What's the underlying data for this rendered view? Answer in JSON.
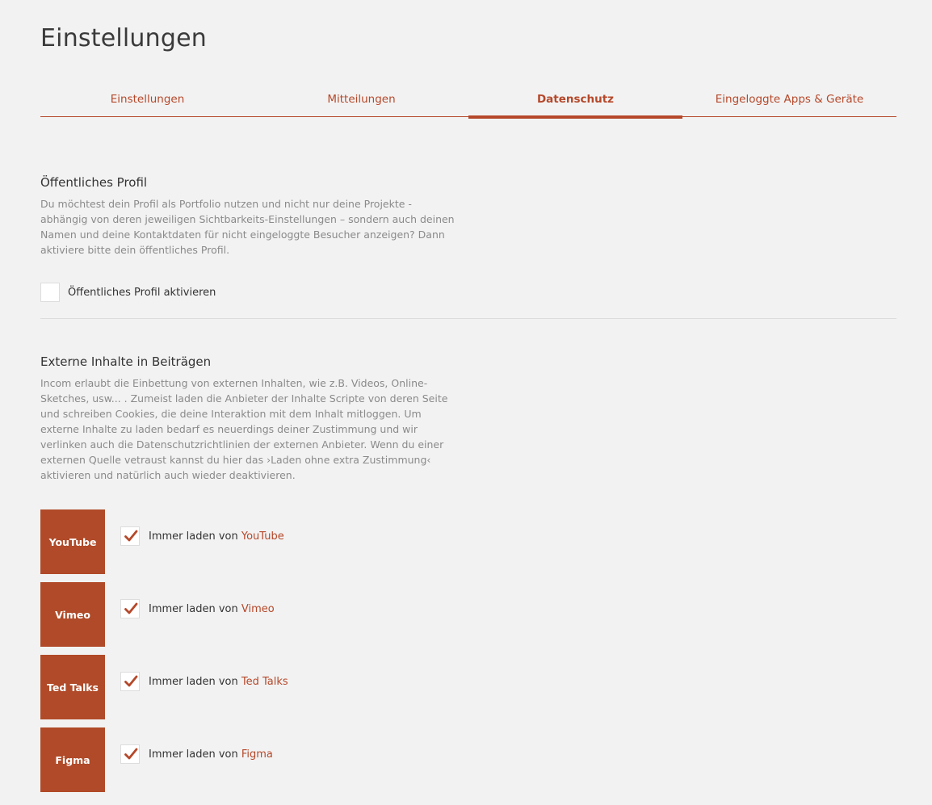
{
  "page": {
    "title": "Einstellungen"
  },
  "tabs": [
    {
      "label": "Einstellungen",
      "active": false
    },
    {
      "label": "Mitteilungen",
      "active": false
    },
    {
      "label": "Datenschutz",
      "active": true
    },
    {
      "label": "Eingeloggte Apps & Geräte",
      "active": false
    }
  ],
  "public_profile": {
    "heading": "Öffentliches Profil",
    "description": "Du möchtest dein Profil als Portfolio nutzen und nicht nur deine Projekte - abhängig von deren jeweiligen Sichtbarkeits-Einstellungen – sondern auch deinen Namen und deine Kontaktdaten für nicht eingeloggte Besucher anzeigen? Dann aktiviere bitte dein öffentliches Profil.",
    "checkbox_label": "Öffentliches Profil aktivieren",
    "checked": false
  },
  "external_content": {
    "heading": "Externe Inhalte in Beiträgen",
    "description": "Incom erlaubt die Einbettung von externen Inhalten, wie z.B. Videos, Online-Sketches, usw... . Zumeist laden die Anbieter der Inhalte Scripte von deren Seite und schreiben Cookies, die deine Interaktion mit dem Inhalt mitloggen. Um externe Inhalte zu laden bedarf es neuerdings deiner Zustimmung und wir verlinken auch die Datenschutzrichtlinien der externen Anbieter. Wenn du einer externen Quelle vetraust kannst du hier das ›Laden ohne extra Zustimmung‹ aktivieren und natürlich auch wieder deaktivieren.",
    "row_prefix": "Immer laden von ",
    "providers": [
      {
        "name": "YouTube",
        "checked": true
      },
      {
        "name": "Vimeo",
        "checked": true
      },
      {
        "name": "Ted Talks",
        "checked": true
      },
      {
        "name": "Figma",
        "checked": true
      }
    ]
  },
  "colors": {
    "accent": "#b5482a",
    "tile": "#b04a28",
    "background": "#f2f2f2",
    "muted_text": "#8a8a8a"
  },
  "icons": {
    "checkmark": "check-icon"
  }
}
